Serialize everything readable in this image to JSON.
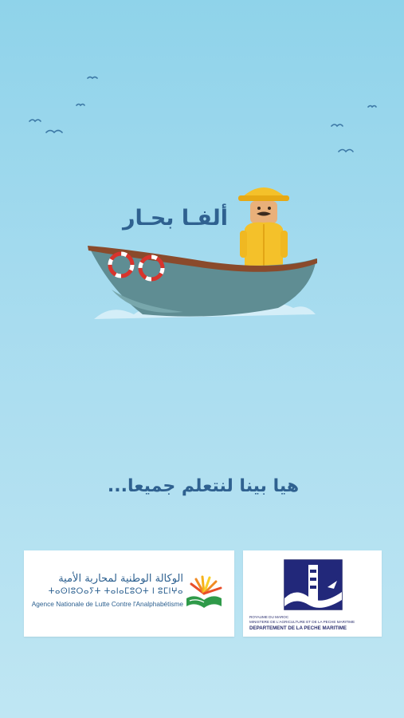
{
  "app_title": "ألفـا بحـار",
  "tagline": "هيا بينا لنتعلم جميعا...",
  "sponsors": {
    "anlca": {
      "name_ar": "الوكالة الوطنية لمحاربة الأمية",
      "name_tifinagh": "ⵜⴰⵙⵏⵓⵔⴰⵢⵜ ⵜⴰⵏⴰⵎⵓⵔⵜ ⵏ ⵓⵎⵏⵖⴰ",
      "name_fr": "Agence Nationale de Lutte Contre l'Analphabétisme",
      "logo_icon": "open-book-sunrise-icon"
    },
    "dpm": {
      "line1": "ROYAUME DU MAROC",
      "line2": "MINISTERE DE L'AGRICULTURE ET DE LA PECHE MARITIME",
      "line3": "DEPARTEMENT DE LA PECHE MARITIME",
      "logo_icon": "lighthouse-waves-icon"
    }
  },
  "colors": {
    "sky_top": "#8fd3ea",
    "sky_bottom": "#bfe6f3",
    "title_blue": "#2f6190",
    "fisherman_yellow": "#f4c12a",
    "boat_hull": "#5f8d93",
    "boat_rim": "#8a4a2b",
    "lifebuoy_red": "#d8342c"
  }
}
